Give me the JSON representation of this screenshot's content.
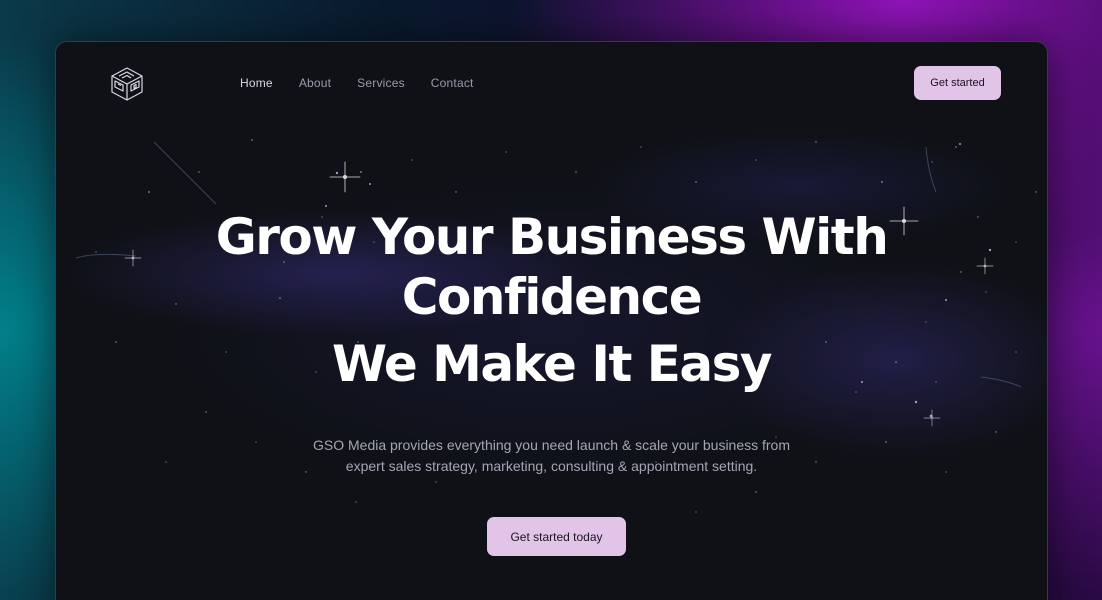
{
  "nav": {
    "logo_icon": "gso-cube-logo-icon",
    "links": [
      {
        "label": "Home",
        "active": true
      },
      {
        "label": "About",
        "active": false
      },
      {
        "label": "Services",
        "active": false
      },
      {
        "label": "Contact",
        "active": false
      }
    ],
    "cta_label": "Get started"
  },
  "hero": {
    "headline": "Grow Your Business With Confidence",
    "subheadline": "We Make It Easy",
    "description": "GSO Media provides everything you need launch & scale your business from expert sales strategy, marketing, consulting & appointment setting.",
    "cta_label": "Get started today"
  },
  "colors": {
    "accent": "#e2c4e8",
    "frame_bg": "#0f1117",
    "text_primary": "#ffffff",
    "text_muted": "#a4a6b3"
  }
}
